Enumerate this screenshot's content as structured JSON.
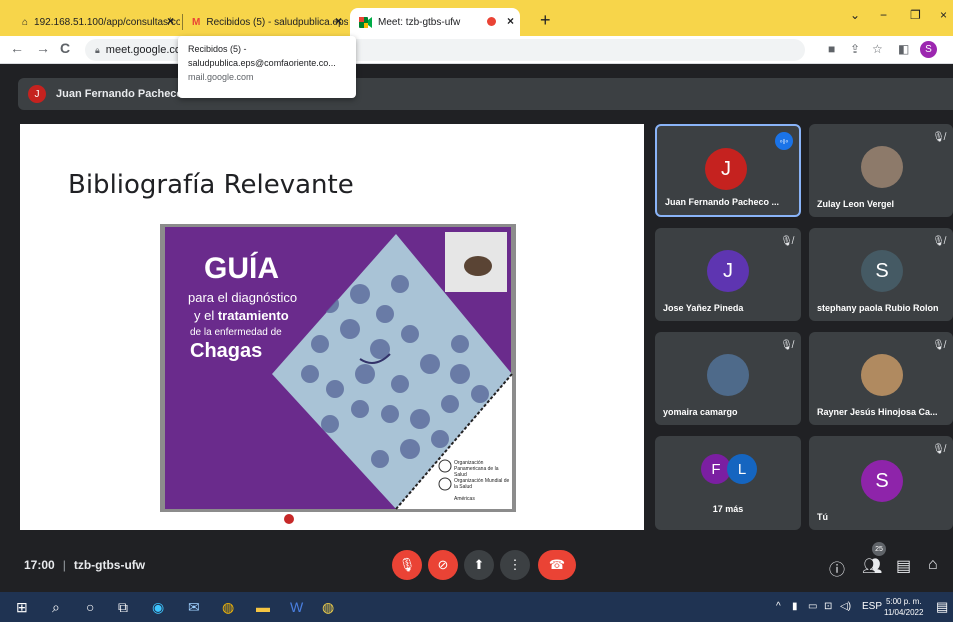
{
  "browser": {
    "tabs": [
      {
        "title": "192.168.51.100/app/consultas/co",
        "icon": "page-icon",
        "active": false
      },
      {
        "title": "Recibidos (5) - saludpublica.eps",
        "icon": "gmail-icon",
        "active": false
      },
      {
        "title": "Meet: tzb-gtbs-ufw",
        "icon": "meet-icon",
        "active": true
      }
    ],
    "url": "meet.google.co",
    "profile_initial": "S"
  },
  "tooltip": {
    "title": "Recibidos (5) -",
    "subtitle": "saludpublica.eps@comfaoriente.co...",
    "domain": "mail.google.com"
  },
  "presenter": {
    "initial": "J",
    "name": "Juan Fernando Pacheco N"
  },
  "slide": {
    "title": "Bibliografía Relevante",
    "book": {
      "heading": "GUÍA",
      "line1": "para el diagnóstico",
      "line2a": "y el ",
      "line2b": "tratamiento",
      "line3": "de la enfermedad de",
      "line4": "Chagas",
      "org1": "Organización Panamericana de la Salud",
      "org2": "Organización Mundial de la Salud",
      "org3": "Américas"
    }
  },
  "participants": [
    {
      "name": "Juan Fernando Pacheco ...",
      "initial": "J",
      "avatar_color": "#c5221f",
      "type": "initial",
      "speaking": true,
      "muted": false
    },
    {
      "name": "Zulay Leon Vergel",
      "initial": "",
      "avatar_color": "#8d7a6a",
      "type": "photo",
      "speaking": false,
      "muted": true
    },
    {
      "name": "Jose Yañez Pineda",
      "initial": "J",
      "avatar_color": "#5e35b1",
      "type": "initial",
      "speaking": false,
      "muted": true
    },
    {
      "name": "stephany paola Rubio Rolon",
      "initial": "S",
      "avatar_color": "#455a64",
      "type": "initial",
      "speaking": false,
      "muted": true
    },
    {
      "name": "yomaira camargo",
      "initial": "",
      "avatar_color": "#4e6a8a",
      "type": "photo",
      "speaking": false,
      "muted": true
    },
    {
      "name": "Rayner Jesús Hinojosa Ca...",
      "initial": "",
      "avatar_color": "#b08a60",
      "type": "photo",
      "speaking": false,
      "muted": true
    },
    {
      "name": "17 más",
      "initials": [
        "F",
        "L"
      ],
      "avatar_colors": [
        "#7b1fa2",
        "#1565c0"
      ],
      "type": "more"
    },
    {
      "name": "Tú",
      "initial": "S",
      "avatar_color": "#8e24aa",
      "type": "initial",
      "speaking": false,
      "muted": true
    }
  ],
  "controls": {
    "time": "17:00",
    "meeting_code": "tzb-gtbs-ufw",
    "participant_count": "25"
  },
  "taskbar": {
    "lang": "ESP",
    "time": "5:00 p. m.",
    "date": "11/04/2022"
  },
  "colors": {
    "tab_strip": "#f7d54a",
    "meet_bg": "#202124",
    "tile_bg": "#3c4043",
    "danger": "#ea4335",
    "book_purple": "#6a2b8c"
  }
}
